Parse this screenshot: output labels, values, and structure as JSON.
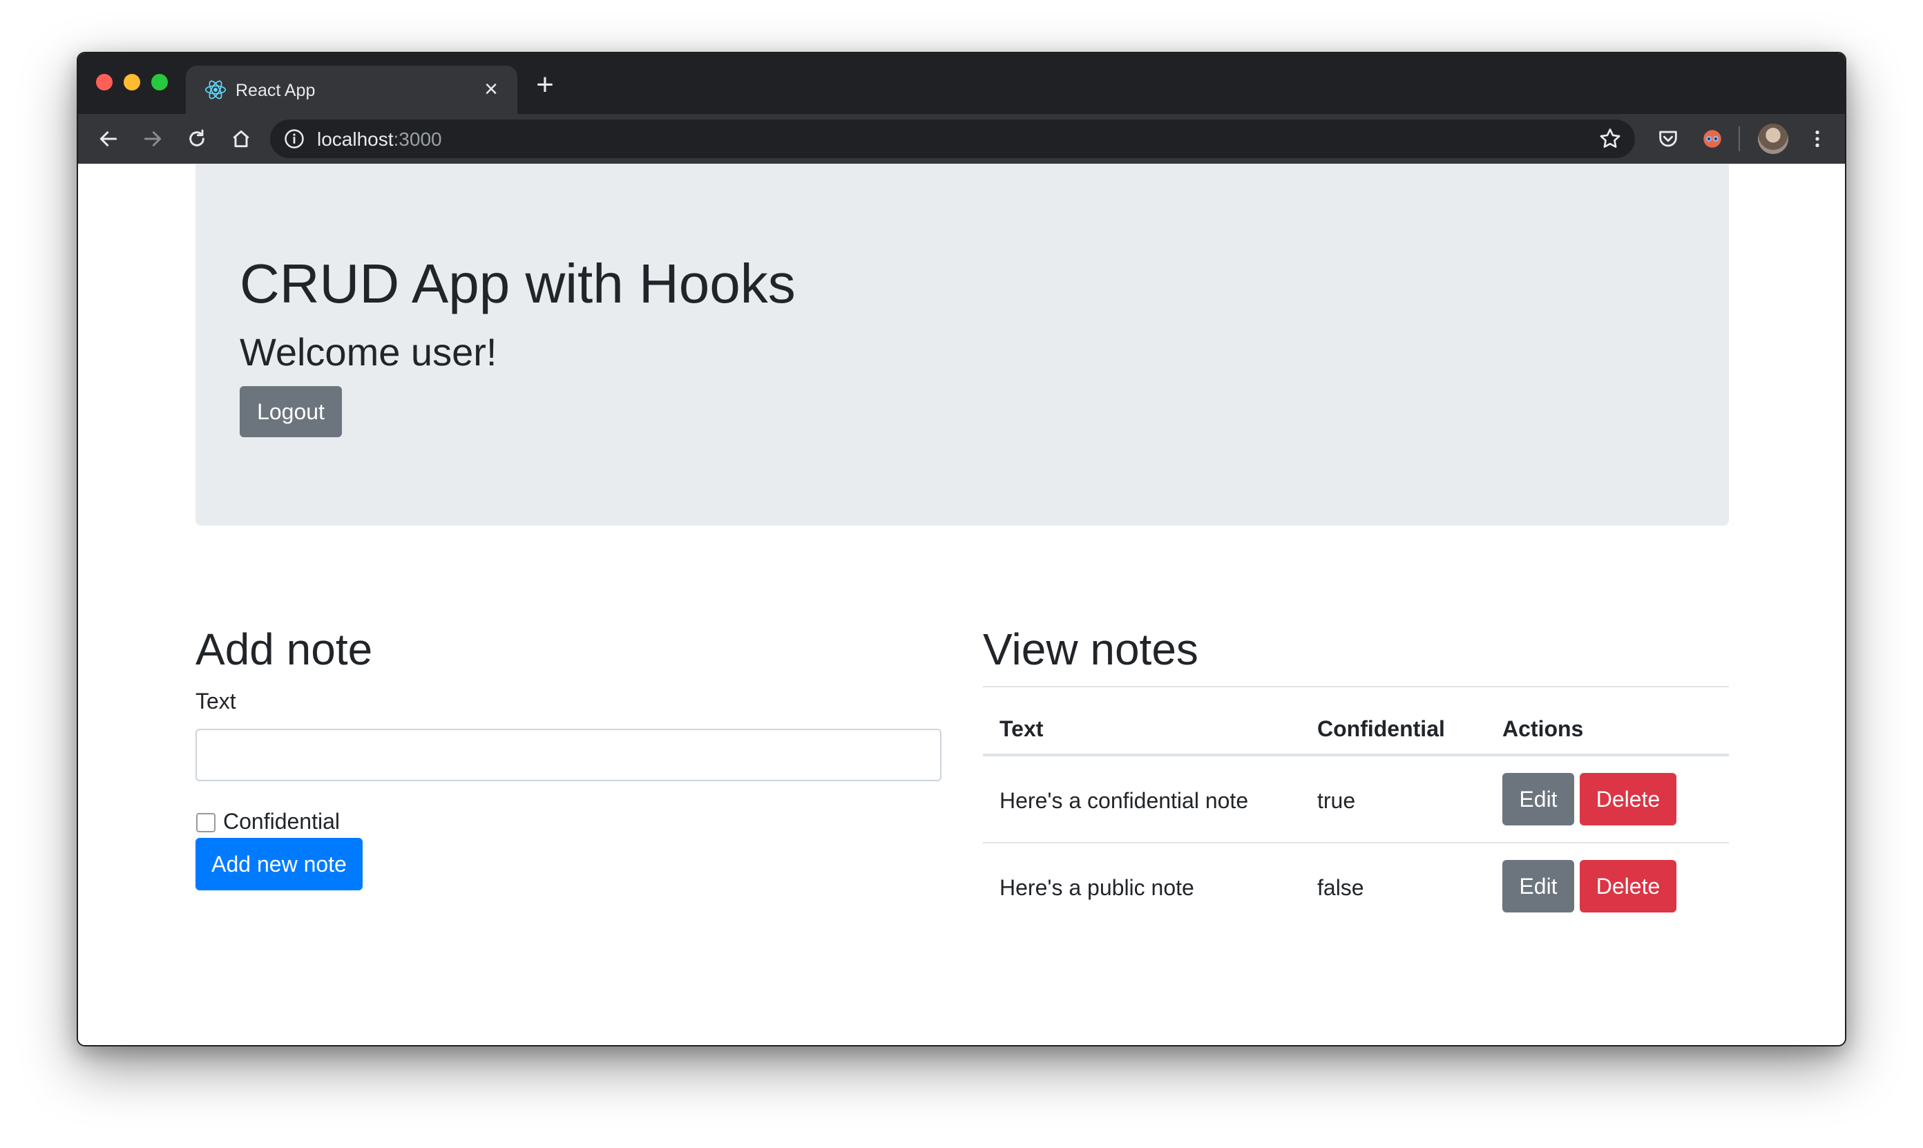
{
  "browser": {
    "tab_title": "React App",
    "url_host": "localhost",
    "url_port": ":3000"
  },
  "header": {
    "title": "CRUD App with Hooks",
    "welcome": "Welcome user!",
    "logout_label": "Logout"
  },
  "add_note": {
    "heading": "Add note",
    "text_label": "Text",
    "text_value": "",
    "confidential_label": "Confidential",
    "confidential_checked": false,
    "submit_label": "Add new note"
  },
  "view_notes": {
    "heading": "View notes",
    "columns": [
      "Text",
      "Confidential",
      "Actions"
    ],
    "rows": [
      {
        "text": "Here's a confidential note",
        "confidential": "true",
        "edit_label": "Edit",
        "delete_label": "Delete"
      },
      {
        "text": "Here's a public note",
        "confidential": "false",
        "edit_label": "Edit",
        "delete_label": "Delete"
      }
    ]
  },
  "colors": {
    "primary": "#007bff",
    "secondary": "#6c757d",
    "danger": "#dc3545",
    "jumbotron": "#e9ecef"
  }
}
